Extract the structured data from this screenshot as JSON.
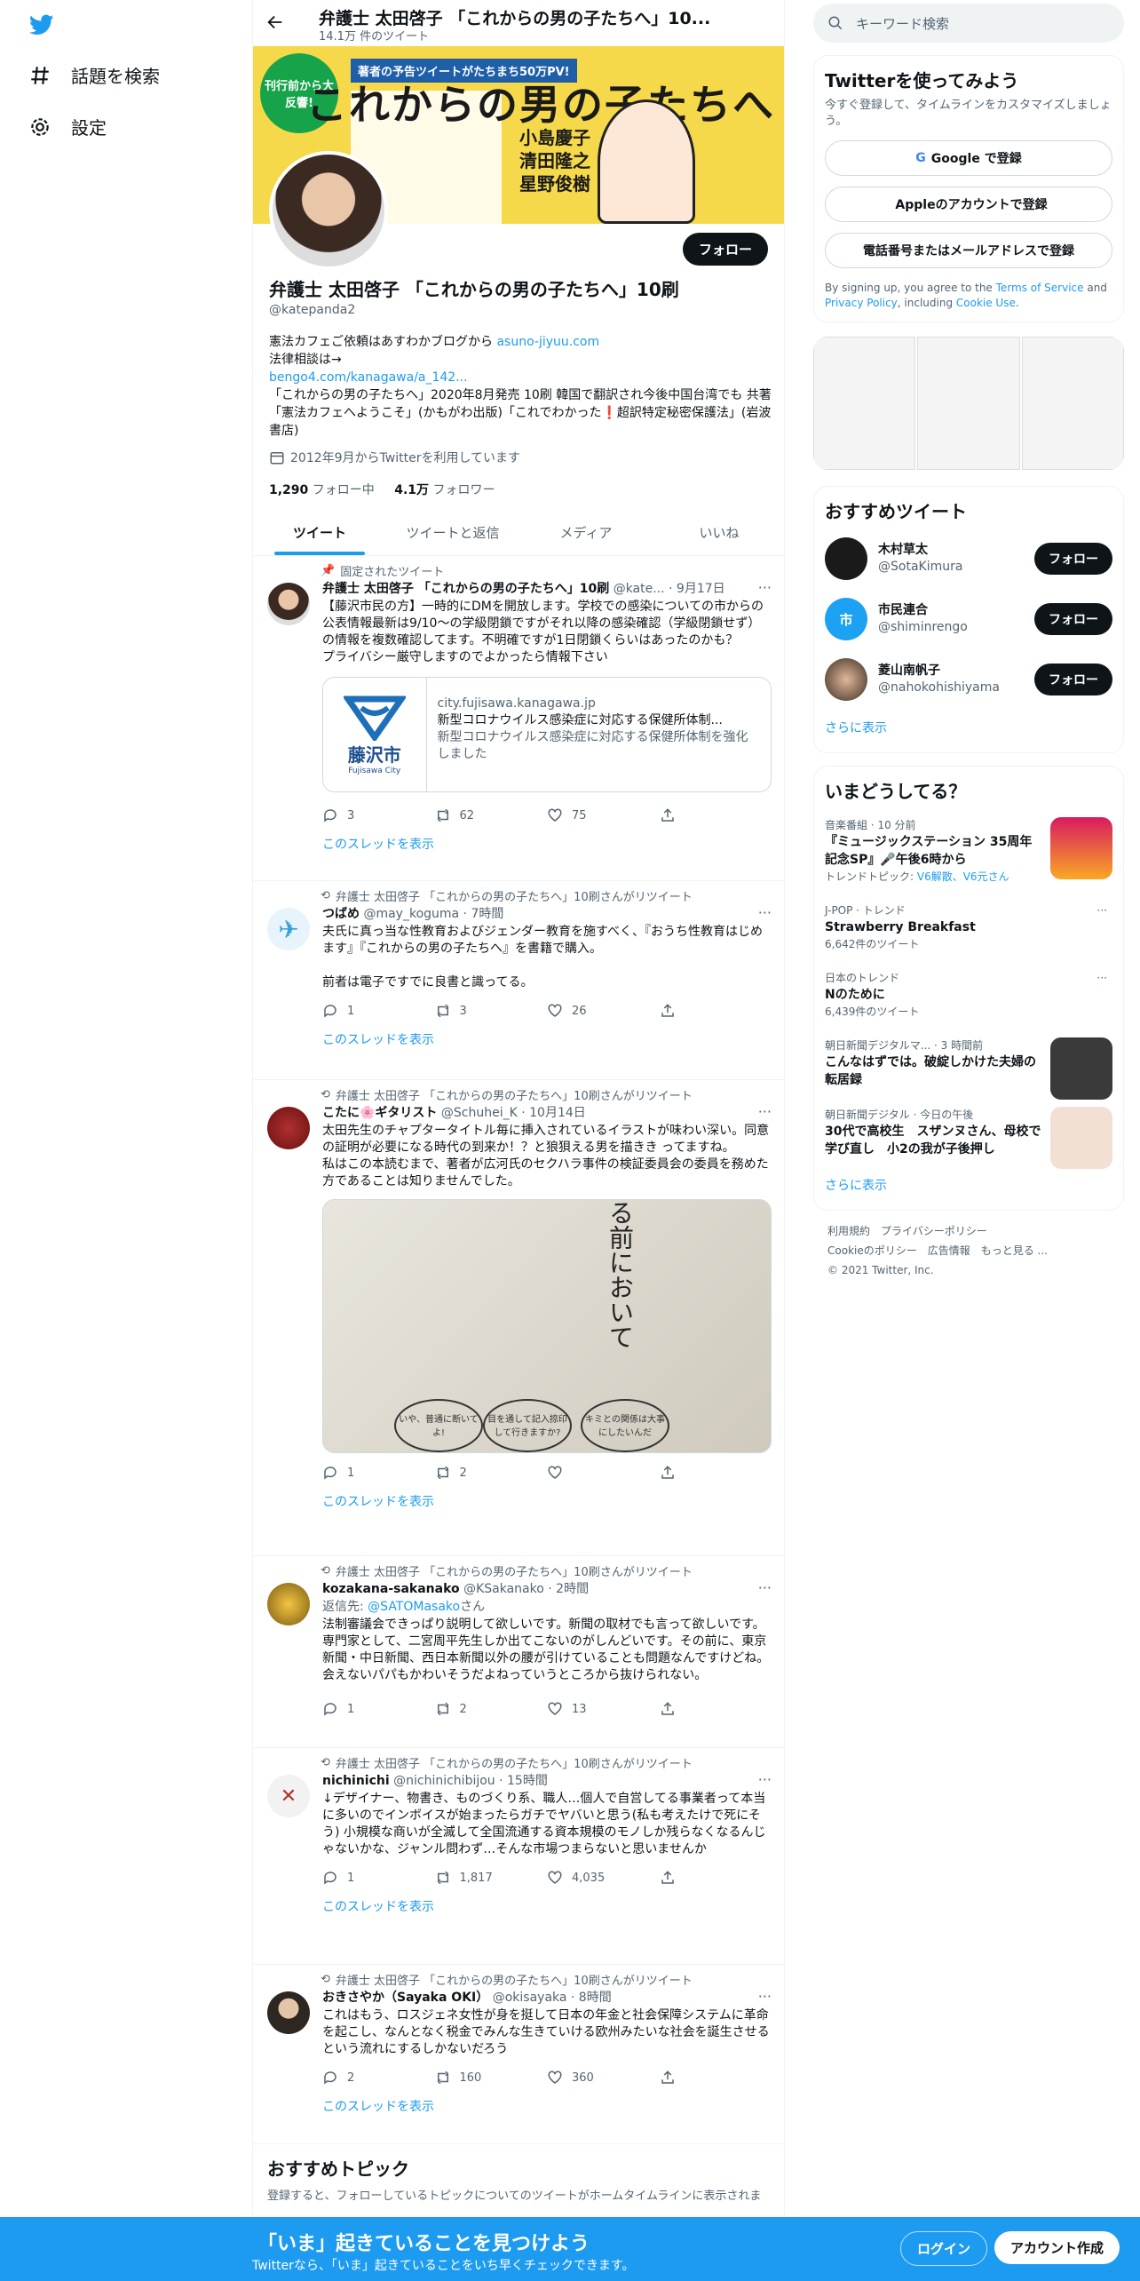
{
  "nav": {
    "explore": "話題を検索",
    "settings": "設定"
  },
  "header": {
    "title": "弁護士 太田啓子 「これからの男の子たちへ」10...",
    "tweet_count": "14.1万 件のツイート"
  },
  "banner": {
    "headline": "これからの男の子たちへ",
    "promo": "刊行前から大反響!",
    "promo2": "著者の予告ツイートがたちまち50万PV!",
    "names": "小島慶子\n清田隆之\n星野俊樹"
  },
  "profile": {
    "follow": "フォロー",
    "name": "弁護士 太田啓子 「これからの男の子たちへ」10刷",
    "handle": "@katepanda2",
    "bio1": "憲法カフェご依頼はあすわかブログから ",
    "bio1_link": "asuno-jiyuu.com",
    "bio2": "法律相談は→",
    "bio2_link": "bengo4.com/kanagawa/a_142...",
    "bio3": "「これからの男の子たちへ」2020年8月発売 10刷 韓国で翻訳され今後中国台湾でも 共著「憲法カフェへようこそ」(かもがわ出版)「これでわかった❗️超訳特定秘密保護法」(岩波書店)",
    "joined": "2012年9月からTwitterを利用しています",
    "following_n": "1,290",
    "following_l": " フォロー中",
    "followers_n": "4.1万",
    "followers_l": " フォロワー"
  },
  "tabs": [
    "ツイート",
    "ツイートと返信",
    "メディア",
    "いいね"
  ],
  "tweets": [
    {
      "ctx": "固定されたツイート",
      "line": "弁護士 太田啓子 「これからの男の子たちへ」10刷",
      "handle": "@kate... · 9月17日",
      "text": "【藤沢市民の方】一時的にDMを開放します。学校での感染についての市からの公表情報最新は9/10～の学級閉鎖ですがそれ以降の感染確認（学級閉鎖せず）の情報を複数確認してます。不明確ですが1日閉鎖くらいはあったのかも？\nプライバシー厳守しますのでよかったら情報下さい",
      "card_domain": "city.fujisawa.kanagawa.jp",
      "card_title": "新型コロナウイルス感染症に対応する保健所体制...",
      "card_desc": "新型コロナウイルス感染症に対応する保健所体制を強化しました",
      "card_logo": "藤沢市",
      "card_logo_en": "Fujisawa City",
      "reply": "3",
      "rt": "62",
      "like": "75",
      "thread": "このスレッドを表示"
    },
    {
      "ctx": "弁護士 太田啓子 「これからの男の子たちへ」10刷さんがリツイート",
      "line": "つばめ",
      "handle": "@may_koguma · 7時間",
      "text": "夫氏に真っ当な性教育およびジェンダー教育を施すべく、『おうち性教育はじめます』『これからの男の子たちへ』を書籍で購入。\n\n前者は電子ですでに良書と識ってる。",
      "reply": "1",
      "rt": "3",
      "like": "26",
      "thread": "このスレッドを表示"
    },
    {
      "ctx": "弁護士 太田啓子 「これからの男の子たちへ」10刷さんがリツイート",
      "line": "こたに🌸ギタリスト",
      "handle": "@Schuhei_K · 10月14日",
      "text": "太田先生のチャプタータイトル毎に挿入されているイラストが味わい深い。同意の証明が必要になる時代の到来か！？と狼狽える男を描きき ってますね。\n私はこの本読むまで、著者が広河氏のセクハラ事件の検証委員会の委員を務めた方であることは知りませんでした。",
      "photo_text": "る前において",
      "b1": "いや、普通に断いてよ!",
      "b2": "目を通して記入捺印して行きますか?",
      "b3": "キミとの関係は大事にしたいんだ",
      "reply": "1",
      "rt": "2",
      "like": "",
      "thread": "このスレッドを表示"
    },
    {
      "ctx": "弁護士 太田啓子 「これからの男の子たちへ」10刷さんがリツイート",
      "line": "kozakana-sakanako",
      "handle": "@KSakanako · 2時間",
      "reply_to": "返信先: ",
      "reply_to_link": "@SATOMasako",
      "reply_to_suffix": "さん",
      "text": "法制審議会できっぱり説明して欲しいです。新聞の取材でも言って欲しいです。専門家として、二宮周平先生しか出てこないのがしんどいです。その前に、東京新聞・中日新聞、西日本新聞以外の腰が引けていることも問題なんですけどね。会えないパパもかわいそうだよねっていうところから抜けられない。",
      "reply": "1",
      "rt": "2",
      "like": "13",
      "thread": ""
    },
    {
      "ctx": "弁護士 太田啓子 「これからの男の子たちへ」10刷さんがリツイート",
      "line": "nichinichi",
      "handle": "@nichinichibijou · 15時間",
      "text": "↓デザイナー、物書き、ものづくり系、職人…個人で自営してる事業者って本当に多いのでインボイスが始まったらガチでヤバいと思う(私も考えたけで死にそう) 小規模な商いが全滅して全国流通する資本規模のモノしか残らなくなるんじゃないかな、ジャンル問わず…そんな市場つまらないと思いませんか",
      "reply": "1",
      "rt": "1,817",
      "like": "4,035",
      "thread": "このスレッドを表示"
    },
    {
      "ctx": "弁護士 太田啓子 「これからの男の子たちへ」10刷さんがリツイート",
      "line": "おきさやか（Sayaka OKI）",
      "handle": "@okisayaka · 8時間",
      "text": "これはもう、ロスジェネ女性が身を挺して日本の年金と社会保障システムに革命を起こし、なんとなく税金でみんな生きていける欧州みたいな社会を誕生させるという流れにするしかないだろう",
      "reply": "2",
      "rt": "160",
      "like": "360",
      "thread": "このスレッドを表示"
    }
  ],
  "topics": {
    "title": "おすすめトピック",
    "desc": "登録すると、フォローしているトピックについてのツイートがホームタイムラインに表示されま"
  },
  "right": {
    "search_ph": "キーワード検索",
    "signup_title": "Twitterを使ってみよう",
    "signup_sub": "今すぐ登録して、タイムラインをカスタマイズしましょう。",
    "google": "Google で登録",
    "apple": "Appleのアカウントで登録",
    "phone": "電話番号またはメールアドレスで登録",
    "fine1": "By signing up, you agree to the ",
    "tos": "Terms of Service",
    "fine2": " and ",
    "pp": "Privacy Policy",
    "fine3": ", including ",
    "cookie": "Cookie Use",
    "fine4": ".",
    "rec_title": "おすすめツイート",
    "rec": [
      {
        "name": "木村草太",
        "handle": "@SotaKimura"
      },
      {
        "name": "市民連合",
        "handle": "@shiminrengo"
      },
      {
        "name": "菱山南帆子",
        "handle": "@nahokohishiyama"
      }
    ],
    "follow": "フォロー",
    "more": "さらに表示",
    "trend_title": "いまどうしてる？",
    "t1_meta": "音楽番組 · 10 分前",
    "t1_title": "『ミュージックステーション 35周年記念SP』🎤午後6時から",
    "t1_sub": "トレンドトピック: ",
    "t1_links": "V6解散、V6元さん",
    "t2_meta": "J-POP · トレンド",
    "t2_title": "Strawberry Breakfast",
    "t2_count": "6,642件のツイート",
    "t3_meta": "日本のトレンド",
    "t3_title": "Nのために",
    "t3_count": "6,439件のツイート",
    "t4_meta": "朝日新聞デジタルマ... · 3 時間前",
    "t4_title": "こんなはずでは。破綻しかけた夫婦の転居録",
    "t5_meta": "朝日新聞デジタル · 今日の午後",
    "t5_title": "30代で高校生　スザンヌさん、母校で学び直し　小2の我が子後押し",
    "footer1": "利用規約　プライバシーポリシー",
    "footer2": "Cookieのポリシー　広告情報　もっと見る ...",
    "footer3": "© 2021 Twitter, Inc."
  },
  "bottom": {
    "title": "「いま」起きていることを見つけよう",
    "sub": "Twitterなら、「いま」起きていることをいち早くチェックできます。",
    "login": "ログイン",
    "signup": "アカウント作成"
  }
}
